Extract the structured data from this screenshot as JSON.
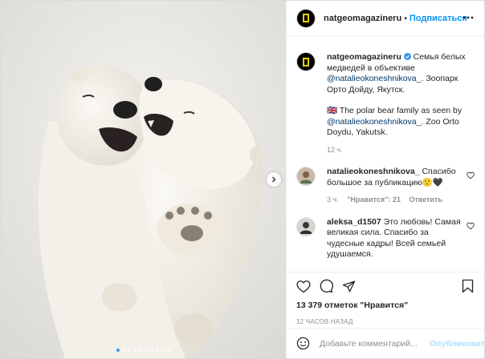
{
  "header": {
    "username": "natgeomagazineru",
    "separator": "•",
    "follow_label": "Подписаться"
  },
  "caption": {
    "username": "natgeomagazineru",
    "text_ru_1": "Семья белых медведей в объективе",
    "mention_1": "@natalieokoneshnikova_",
    "text_ru_2": ". Зоопарк Орто Дойду, Якутск.",
    "flag": "🇬🇧",
    "text_en_1": " The polar bear family as seen by",
    "mention_2": "@natalieokoneshnikova_",
    "text_en_2": ". Zoo Orto Doydu, Yakutsk.",
    "time": "12 ч."
  },
  "comments": [
    {
      "username": "natalieokoneshnikova_",
      "text": "Спасибо большое за публикацию🙂🖤",
      "time": "3 ч.",
      "likes": "\"Нравится\": 21",
      "reply": "Ответить"
    },
    {
      "username": "aleksa_d1507",
      "text": "Это любовь! Самая великая сила. Спасибо за чудесные кадры! Всей семьей удушаемся."
    }
  ],
  "likes": {
    "count": "13 379",
    "label": "отметок \"Нравится\""
  },
  "posted_ago": "12 ЧАСОВ НАЗАД",
  "add_comment": {
    "placeholder": "Добавьте комментарий...",
    "publish_label": "Опубликовать"
  },
  "carousel": {
    "slides": 10,
    "active_index": 0
  },
  "colors": {
    "accent": "#0095f6",
    "verified": "#3897f0",
    "natgeo_yellow": "#ffce00"
  }
}
